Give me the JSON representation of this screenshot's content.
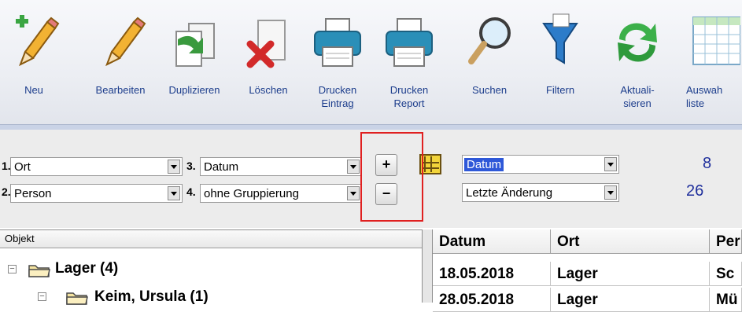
{
  "toolbar": {
    "buttons": [
      {
        "label": "Neu",
        "icon": "pencil-new-icon"
      },
      {
        "label": "Bearbeiten",
        "icon": "pencil-icon"
      },
      {
        "label": "Duplizieren",
        "icon": "duplicate-icon"
      },
      {
        "label": "Löschen",
        "icon": "delete-icon"
      },
      {
        "label": "Drucken\nEintrag",
        "icon": "printer-icon"
      },
      {
        "label": "Drucken\nReport",
        "icon": "printer-icon"
      },
      {
        "label": "Suchen",
        "icon": "magnifier-icon"
      },
      {
        "label": "Filtern",
        "icon": "funnel-icon"
      },
      {
        "label": "Aktuali-\nsieren",
        "icon": "refresh-icon"
      },
      {
        "label": "Auswah\nliste",
        "icon": "table-icon"
      }
    ]
  },
  "grouping": {
    "rows": [
      {
        "num": "1.",
        "value": "Ort"
      },
      {
        "num": "2.",
        "value": "Person"
      },
      {
        "num": "3.",
        "value": "Datum"
      },
      {
        "num": "4.",
        "value": "ohne Gruppierung"
      }
    ],
    "add_symbol": "+",
    "remove_symbol": "−"
  },
  "sorting": {
    "field1": "Datum",
    "field2": "Letzte Änderung",
    "count1": "8",
    "count2": "26"
  },
  "tree": {
    "header": "Objekt",
    "items": [
      "Lager  (4)",
      "Keim, Ursula  (1)"
    ]
  },
  "grid": {
    "columns": [
      "Datum",
      "Ort",
      "Per"
    ],
    "rows": [
      [
        "18.05.2018",
        "Lager",
        "Sc"
      ],
      [
        "28.05.2018",
        "Lager",
        "Mü"
      ]
    ]
  },
  "colors": {
    "accent": "#2e58d8",
    "highlight_box": "#e02020",
    "count_text": "#1f2f9c"
  }
}
